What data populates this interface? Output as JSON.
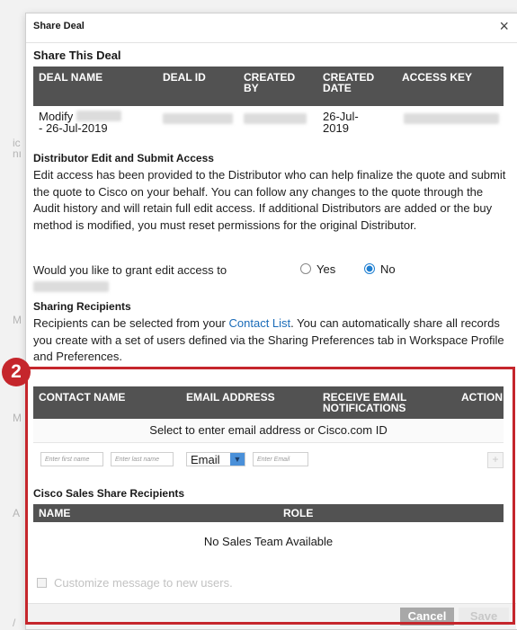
{
  "background_fragments": [
    "ic",
    "nı",
    "M",
    "M",
    "A",
    "/"
  ],
  "modal": {
    "title": "Share Deal",
    "close_label": "×"
  },
  "share_section": {
    "heading": "Share This Deal",
    "columns": [
      "DEAL NAME",
      "DEAL ID",
      "CREATED BY",
      "CREATED DATE",
      "ACCESS KEY"
    ],
    "row": {
      "deal_name_line1": "Modify",
      "deal_name_line2": "- 26-Jul-2019",
      "created_date_line1": "26-Jul-",
      "created_date_line2": "2019"
    }
  },
  "distributor_section": {
    "heading": "Distributor Edit and Submit Access",
    "paragraph": "Edit access has been provided to the Distributor who can help finalize the quote and submit the quote to Cisco on your behalf. You can follow any changes to the quote through the Audit history and will retain full edit access. If additional Distributors are added or the buy method is modified, you must reset permissions for the original Distributor.",
    "question": "Would you like to grant edit access to",
    "yes_label": "Yes",
    "no_label": "No",
    "selected": "No"
  },
  "sharing_section": {
    "heading": "Sharing Recipients",
    "text_before_link": "Recipients can be selected from your ",
    "link_text": "Contact List",
    "text_after_link": ". You can automatically share all records you create with a set of users defined via the Sharing Preferences tab in Workspace Profile and Preferences.",
    "columns": [
      "CONTACT NAME",
      "EMAIL ADDRESS",
      "RECEIVE EMAIL NOTIFICATIONS",
      "ACTION"
    ],
    "select_prompt": "Select to enter email address or Cisco.com ID",
    "first_name_placeholder": "Enter first name",
    "last_name_placeholder": "Enter last name",
    "type_select_value": "Email",
    "email_placeholder": "Enter Email",
    "add_label": "+"
  },
  "sales_section": {
    "heading": "Cisco Sales Share Recipients",
    "columns": [
      "NAME",
      "ROLE"
    ],
    "empty_text": "No Sales Team Available"
  },
  "customize_label": "Customize message to new users.",
  "footer": {
    "cancel_label": "Cancel",
    "save_label": "Save"
  },
  "annotation": {
    "badge_number": "2",
    "color": "#c5262c"
  }
}
